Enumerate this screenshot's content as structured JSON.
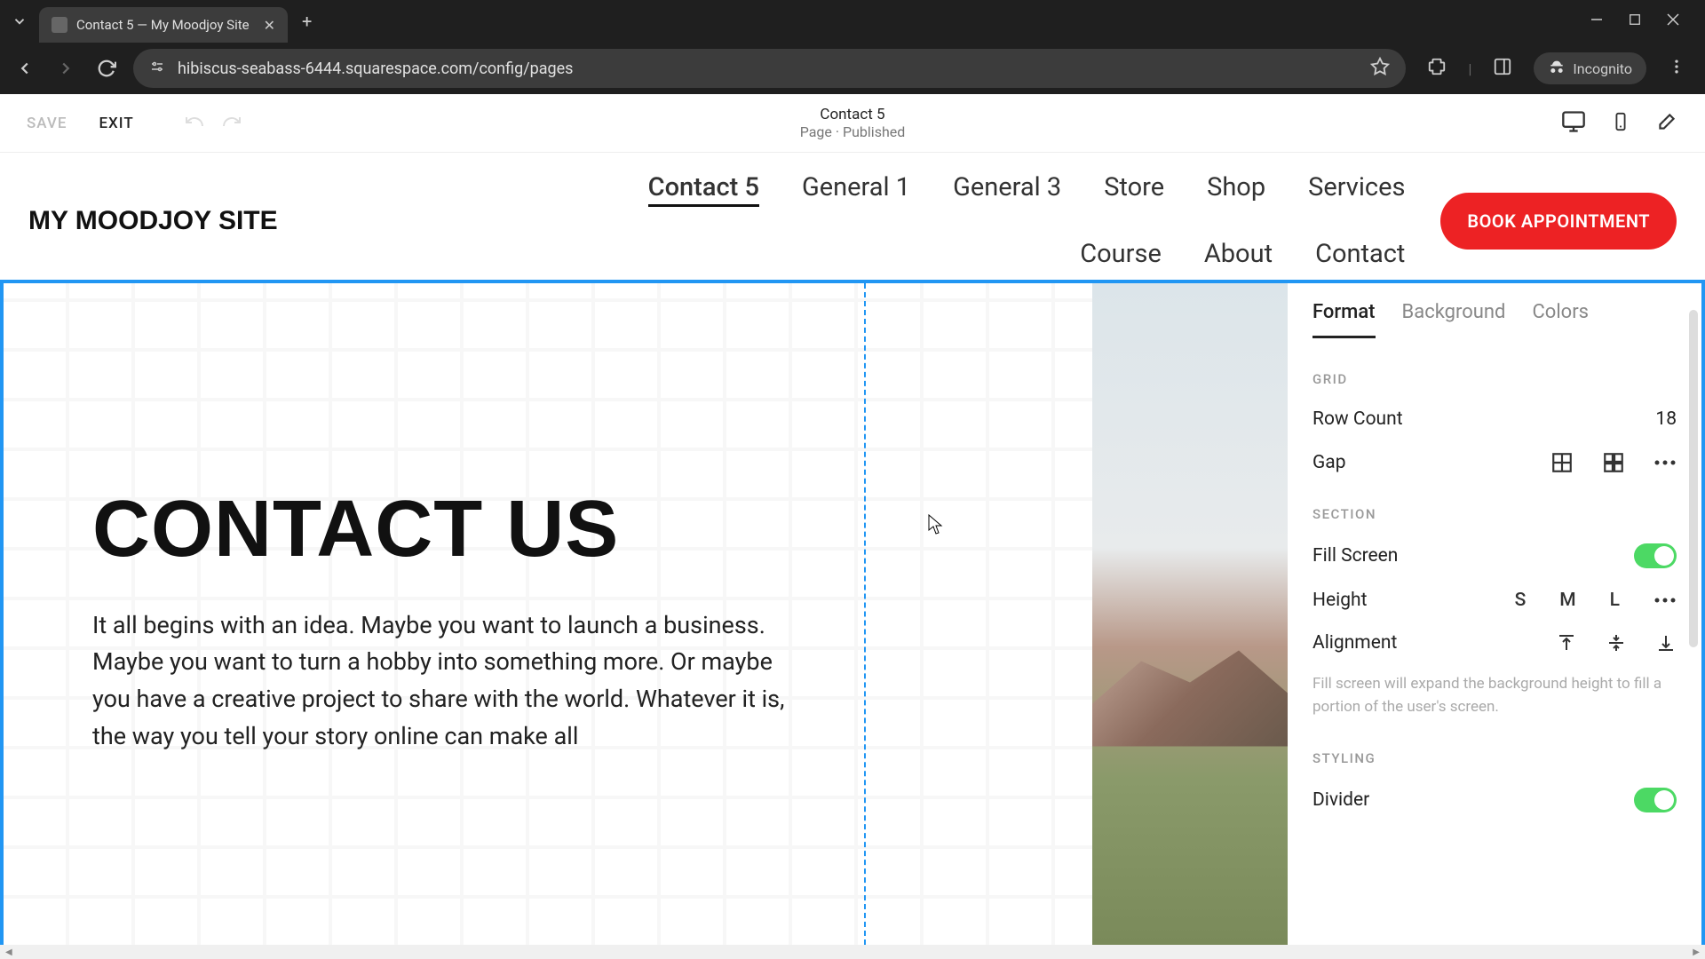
{
  "browser": {
    "tab_title": "Contact 5 — My Moodjoy Site",
    "url": "hibiscus-seabass-6444.squarespace.com/config/pages",
    "incognito_label": "Incognito"
  },
  "editor_bar": {
    "save": "SAVE",
    "exit": "EXIT",
    "page_name": "Contact 5",
    "page_status": "Page · Published"
  },
  "site": {
    "logo": "MY MOODJOY SITE",
    "nav": [
      "Contact 5",
      "General 1",
      "General 3",
      "Store",
      "Shop",
      "Services",
      "Course",
      "About",
      "Contact"
    ],
    "active_nav_index": 0,
    "cta": "BOOK APPOINTMENT"
  },
  "content": {
    "heading": "CONTACT US",
    "body": "It all begins with an idea. Maybe you want to launch a business. Maybe you want to turn a hobby into something more. Or maybe you have a creative project to share with the world. Whatever it is, the way you tell your story online can make all"
  },
  "panel": {
    "tabs": [
      "Format",
      "Background",
      "Colors"
    ],
    "active_tab_index": 0,
    "grid_label": "GRID",
    "row_count_label": "Row Count",
    "row_count_value": "18",
    "gap_label": "Gap",
    "section_label": "SECTION",
    "fill_screen_label": "Fill Screen",
    "fill_screen_on": true,
    "height_label": "Height",
    "height_opts": [
      "S",
      "M",
      "L"
    ],
    "alignment_label": "Alignment",
    "help_text": "Fill screen will expand the background height to fill a portion of the user's screen.",
    "styling_label": "STYLING",
    "divider_label": "Divider",
    "divider_on": true
  }
}
